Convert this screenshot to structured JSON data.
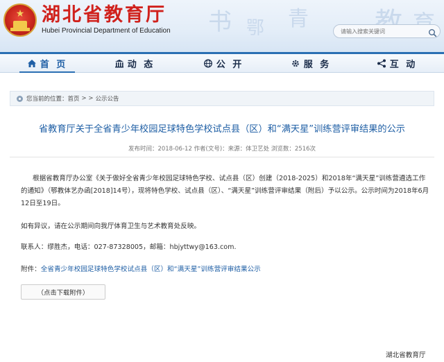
{
  "header": {
    "title": "湖北省教育厅",
    "subtitle": "Hubei Provincial Department of Education",
    "search_placeholder": "请输入搜索关键词"
  },
  "nav": {
    "items": [
      {
        "label": "首 页",
        "icon": "home-icon",
        "active": true
      },
      {
        "label": "动 态",
        "icon": "building-icon",
        "active": false
      },
      {
        "label": "公 开",
        "icon": "globe-icon",
        "active": false
      },
      {
        "label": "服 务",
        "icon": "gear-icon",
        "active": false
      },
      {
        "label": "互 动",
        "icon": "share-icon",
        "active": false
      }
    ]
  },
  "breadcrumb": {
    "prefix": "您当前的位置：",
    "home": "首页",
    "separator": "> >",
    "current": "公示公告"
  },
  "article": {
    "title": "省教育厅关于全省青少年校园足球特色学校试点县（区）和“满天星”训练营评审结果的公示",
    "meta": "发布时间：2018-06-12 作者(文号)：来源：体卫艺处 浏览数：2516次",
    "paragraph1": "根据省教育厅办公室《关于做好全省青少年校园足球特色学校、试点县（区）创建（2018-2025）和2018年“满天星”训练营遴选工作的通知》（鄂教体艺办函[2018]14号），现将特色学校、试点县（区）、“满天星”训练营评审结果（附后）予以公示。公示时间为2018年6月12日至19日。",
    "paragraph2": "如有异议，请在公示期间向我厅体育卫生与艺术教育处反映。",
    "contact": "联系人：缪胜杰，电话：027-87328005，邮箱：hbjyttwy@163.com.",
    "attachment_prefix": "附件：",
    "attachment_link": "全省青少年校园足球特色学校试点县（区）和“满天星”训练营评审结果公示",
    "download_label": "（点击下载附件）",
    "signature": "湖北省教育厅"
  },
  "colors": {
    "brand_red": "#d0211c",
    "nav_blue": "#2a6fb3",
    "link_blue": "#1f5fa5"
  }
}
